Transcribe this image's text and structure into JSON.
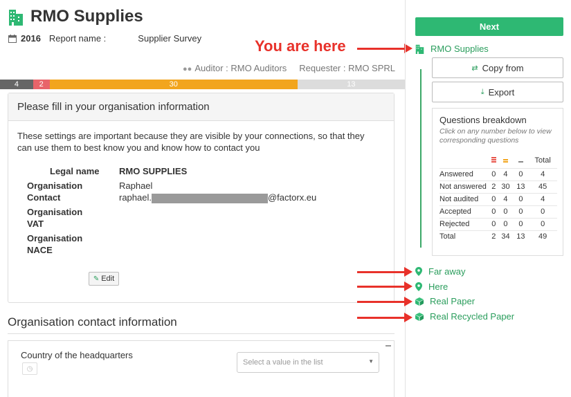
{
  "header": {
    "title": "RMO Supplies",
    "year": "2016",
    "report_name_label": "Report name :",
    "report_name": "Supplier Survey",
    "auditor": "Auditor : RMO Auditors",
    "requester": "Requester : RMO SPRL"
  },
  "annotation": {
    "you_are_here": "You are here"
  },
  "progress": [
    {
      "label": "4",
      "value": 4,
      "color": "#666666"
    },
    {
      "label": "2",
      "value": 2,
      "color": "#e8646a"
    },
    {
      "label": "30",
      "value": 30,
      "color": "#f2a51d"
    },
    {
      "label": "13",
      "value": 13,
      "color": "#dcdcdc"
    }
  ],
  "org_panel": {
    "heading": "Please fill in your organisation information",
    "intro": "These settings are important because they are visible by your connections, so that they can use them to best know you and know how to contact you",
    "legal_name_label": "Legal name",
    "legal_name": "RMO SUPPLIES",
    "contact_label": "Organisation Contact",
    "contact_name": "Raphael",
    "contact_email_prefix": "raphael.",
    "contact_email_suffix": "@factorx.eu",
    "vat_label": "Organisation VAT",
    "nace_label": "Organisation NACE",
    "edit_label": "Edit"
  },
  "contact_section": {
    "title": "Organisation contact information",
    "country_label": "Country of the headquarters",
    "country_placeholder": "Select a value in the list"
  },
  "sidebar": {
    "next_label": "Next",
    "current": "RMO Supplies",
    "copy_from": "Copy from",
    "export": "Export",
    "breakdown": {
      "title": "Questions breakdown",
      "note": "Click on any number below to view corresponding questions",
      "total_header": "Total",
      "rows": [
        {
          "label": "Answered",
          "c1": "0",
          "c2": "4",
          "c3": "0",
          "total": "4"
        },
        {
          "label": "Not answered",
          "c1": "2",
          "c2": "30",
          "c3": "13",
          "total": "45"
        },
        {
          "label": "Not audited",
          "c1": "0",
          "c2": "4",
          "c3": "0",
          "total": "4"
        },
        {
          "label": "Accepted",
          "c1": "0",
          "c2": "0",
          "c3": "0",
          "total": "0"
        },
        {
          "label": "Rejected",
          "c1": "0",
          "c2": "0",
          "c3": "0",
          "total": "0"
        },
        {
          "label": "Total",
          "c1": "2",
          "c2": "34",
          "c3": "13",
          "total": "49"
        }
      ]
    },
    "items": [
      {
        "label": "Far away",
        "icon": "location-pin-icon"
      },
      {
        "label": "Here",
        "icon": "location-pin-icon"
      },
      {
        "label": "Real Paper",
        "icon": "box-icon"
      },
      {
        "label": "Real Recycled Paper",
        "icon": "box-icon"
      }
    ]
  },
  "colors": {
    "accent": "#2eb873",
    "link": "#2a9d5c",
    "annotation": "#e8312a"
  }
}
